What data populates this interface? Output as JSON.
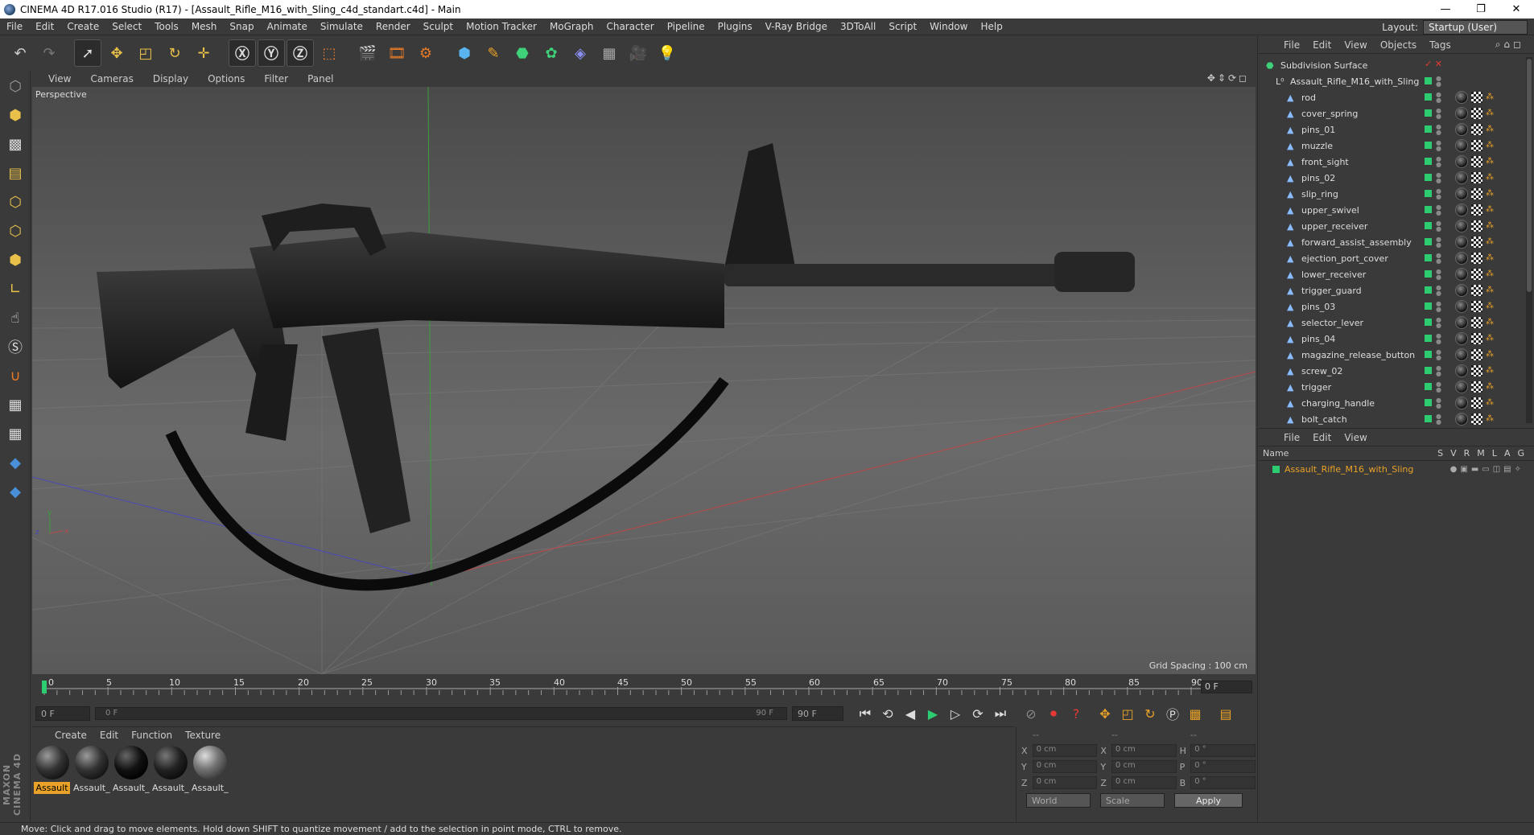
{
  "window": {
    "title": "CINEMA 4D R17.016 Studio (R17) - [Assault_Rifle_M16_with_Sling_c4d_standart.c4d] - Main",
    "minimize": "—",
    "restore": "❐",
    "close": "✕"
  },
  "menubar": {
    "items": [
      "File",
      "Edit",
      "Create",
      "Select",
      "Tools",
      "Mesh",
      "Snap",
      "Animate",
      "Simulate",
      "Render",
      "Sculpt",
      "Motion Tracker",
      "MoGraph",
      "Character",
      "Pipeline",
      "Plugins",
      "V-Ray Bridge",
      "3DToAll",
      "Script",
      "Window",
      "Help"
    ],
    "layout_label": "Layout:",
    "layout_value": "Startup (User)"
  },
  "viewport": {
    "menu": [
      "View",
      "Cameras",
      "Display",
      "Options",
      "Filter",
      "Panel"
    ],
    "camera_label": "Perspective",
    "grid_spacing": "Grid Spacing : 100 cm"
  },
  "timeline": {
    "ticks": [
      "0",
      "5",
      "10",
      "15",
      "20",
      "25",
      "30",
      "35",
      "40",
      "45",
      "50",
      "55",
      "60",
      "65",
      "70",
      "75",
      "80",
      "85",
      "90"
    ],
    "current_frame": "0 F",
    "start_field": "0 F",
    "range_start": "0 F",
    "range_end": "90 F",
    "end_field": "90 F"
  },
  "materials": {
    "menu": [
      "Create",
      "Edit",
      "Function",
      "Texture"
    ],
    "items": [
      "Assault",
      "Assault_",
      "Assault_",
      "Assault_",
      "Assault_"
    ]
  },
  "attributes": {
    "header": [
      "--",
      "--",
      "--"
    ],
    "rows": [
      {
        "l1": "X",
        "v1": "0 cm",
        "l2": "X",
        "v2": "0 cm",
        "l3": "H",
        "v3": "0 °"
      },
      {
        "l1": "Y",
        "v1": "0 cm",
        "l2": "Y",
        "v2": "0 cm",
        "l3": "P",
        "v3": "0 °"
      },
      {
        "l1": "Z",
        "v1": "0 cm",
        "l2": "Z",
        "v2": "0 cm",
        "l3": "B",
        "v3": "0 °"
      }
    ],
    "coord_mode": "World",
    "scale_mode": "Scale",
    "apply": "Apply"
  },
  "objects": {
    "menu": [
      "File",
      "Edit",
      "View",
      "Objects",
      "Tags"
    ],
    "root": "Subdivision Surface",
    "group": "Assault_Rifle_M16_with_Sling",
    "children": [
      "rod",
      "cover_spring",
      "pins_01",
      "muzzle",
      "front_sight",
      "pins_02",
      "slip_ring",
      "upper_swivel",
      "upper_receiver",
      "forward_assist_assembly",
      "ejection_port_cover",
      "lower_receiver",
      "trigger_guard",
      "pins_03",
      "selector_lever",
      "pins_04",
      "magazine_release_button",
      "screw_02",
      "trigger",
      "charging_handle",
      "bolt_catch"
    ]
  },
  "layers": {
    "menu": [
      "File",
      "Edit",
      "View"
    ],
    "name_col": "Name",
    "cols": [
      "S",
      "V",
      "R",
      "M",
      "L",
      "A",
      "G"
    ],
    "row": "Assault_Rifle_M16_with_Sling"
  },
  "status": "Move: Click and drag to move elements. Hold down SHIFT to quantize movement / add to the selection in point mode, CTRL to remove.",
  "brand": "MAXON CINEMA 4D"
}
